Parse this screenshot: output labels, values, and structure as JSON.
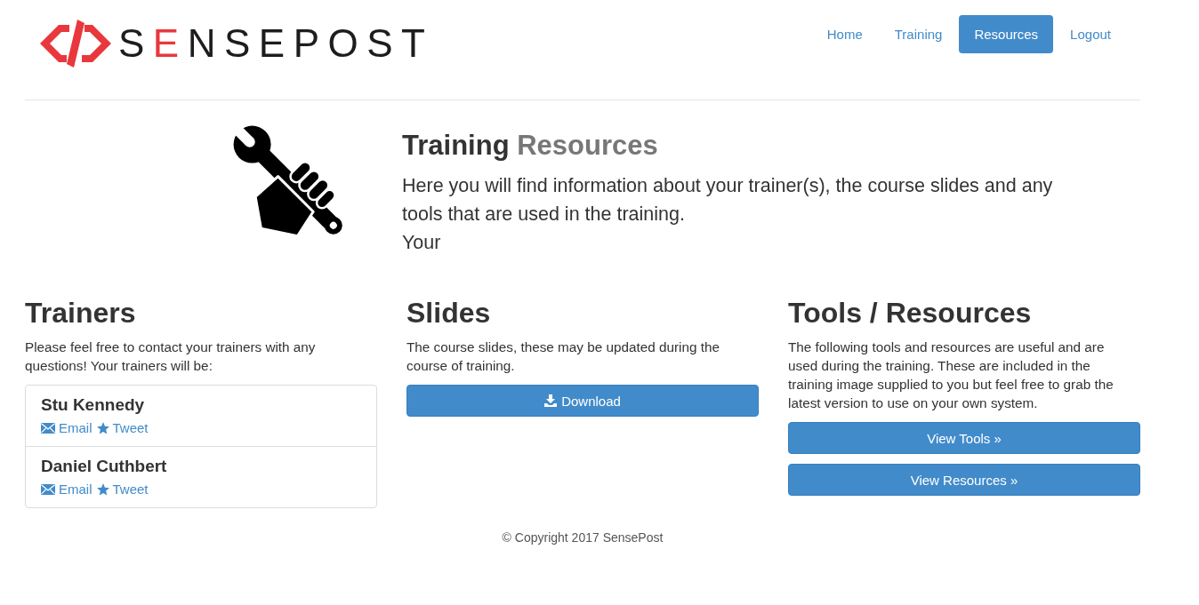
{
  "header": {
    "logo": {
      "wordmark": "SENSEPOST"
    },
    "nav": [
      {
        "label": "Home",
        "selected": false
      },
      {
        "label": "Training",
        "selected": false
      },
      {
        "label": "Resources",
        "selected": true
      },
      {
        "label": "Logout",
        "selected": false
      }
    ]
  },
  "hero": {
    "title": "Training",
    "subtitle": "Resources",
    "lead": "Here you will find information about your trainer(s), the course slides and any tools that are used in the training.",
    "lead_tail": "Your"
  },
  "sections": [
    {
      "kind": "trainers",
      "heading": "Trainers",
      "text": "Please feel free to contact your trainers with any questions! Your trainers will be:",
      "trainers": [
        {
          "name": "Stu Kennedy",
          "links": [
            {
              "kind": "email",
              "label": "Email"
            },
            {
              "kind": "tweet",
              "label": "Tweet"
            }
          ]
        },
        {
          "name": "Daniel Cuthbert",
          "links": [
            {
              "kind": "email",
              "label": "Email"
            },
            {
              "kind": "tweet",
              "label": "Tweet"
            }
          ]
        }
      ]
    },
    {
      "kind": "buttons",
      "heading": "Slides",
      "text": "The course slides, these may be updated during the course of training.",
      "buttons": [
        {
          "kind": "download",
          "label": "Download"
        }
      ]
    },
    {
      "kind": "buttons",
      "heading": "Tools / Resources",
      "text": "The following tools and resources are useful and are used during the training. These are included in the training image supplied to you but feel free to grab the latest version to use on your own system.",
      "buttons": [
        {
          "kind": "plain",
          "label": "View Tools »"
        },
        {
          "kind": "plain",
          "label": "View Resources »"
        }
      ]
    }
  ],
  "footer": {
    "copyright": "© Copyright 2017 SensePost"
  }
}
